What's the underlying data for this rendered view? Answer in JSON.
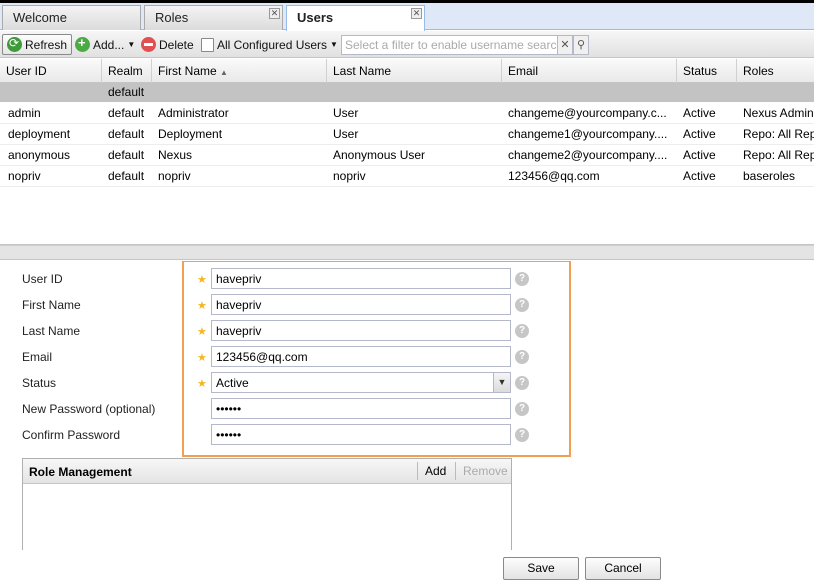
{
  "tabs": [
    {
      "label": "Welcome"
    },
    {
      "label": "Roles"
    },
    {
      "label": "Users"
    }
  ],
  "toolbar": {
    "refresh_label": "Refresh",
    "add_label": "Add...",
    "delete_label": "Delete",
    "filter_label": "All Configured Users",
    "search_placeholder": "Select a filter to enable username search"
  },
  "grid": {
    "headers": [
      "User ID",
      "Realm",
      "First Name",
      "Last Name",
      "Email",
      "Status",
      "Roles"
    ],
    "group_label": "default",
    "rows": [
      {
        "user_id": "admin",
        "realm": "default",
        "first_name": "Administrator",
        "last_name": "User",
        "email": "changeme@yourcompany.c...",
        "status": "Active",
        "roles": "Nexus Admin"
      },
      {
        "user_id": "deployment",
        "realm": "default",
        "first_name": "Deployment",
        "last_name": "User",
        "email": "changeme1@yourcompany....",
        "status": "Active",
        "roles": "Repo: All Rep"
      },
      {
        "user_id": "anonymous",
        "realm": "default",
        "first_name": "Nexus",
        "last_name": "Anonymous User",
        "email": "changeme2@yourcompany....",
        "status": "Active",
        "roles": "Repo: All Rep"
      },
      {
        "user_id": "nopriv",
        "realm": "default",
        "first_name": "nopriv",
        "last_name": "nopriv",
        "email": "123456@qq.com",
        "status": "Active",
        "roles": "baseroles"
      }
    ]
  },
  "form": {
    "user_id_label": "User ID",
    "user_id_value": "havepriv",
    "first_name_label": "First Name",
    "first_name_value": "havepriv",
    "last_name_label": "Last Name",
    "last_name_value": "havepriv",
    "email_label": "Email",
    "email_value": "123456@qq.com",
    "status_label": "Status",
    "status_value": "Active",
    "new_password_label": "New Password (optional)",
    "new_password_value": "••••••",
    "confirm_password_label": "Confirm Password",
    "confirm_password_value": "••••••",
    "required_mark": "★",
    "help_mark": "?"
  },
  "role_management": {
    "title": "Role Management",
    "add_label": "Add",
    "remove_label": "Remove"
  },
  "buttons": {
    "save_label": "Save",
    "cancel_label": "Cancel"
  },
  "colors": {
    "highlight_border": "#f0a050",
    "group_row": "#c3c3c3"
  }
}
